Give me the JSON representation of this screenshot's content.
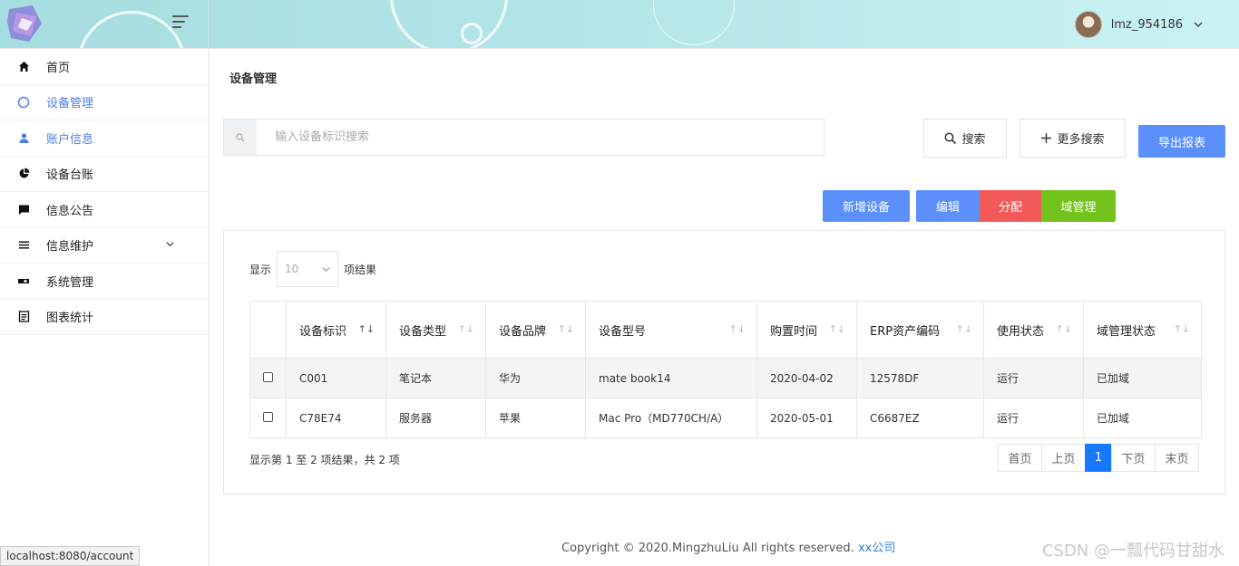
{
  "header": {
    "username": "lmz_954186"
  },
  "sidebar": {
    "items": [
      {
        "label": "首页",
        "icon": "home-icon"
      },
      {
        "label": "设备管理",
        "icon": "circle-icon"
      },
      {
        "label": "账户信息",
        "icon": "user-icon"
      },
      {
        "label": "设备台账",
        "icon": "pie-chart-icon"
      },
      {
        "label": "信息公告",
        "icon": "message-icon"
      },
      {
        "label": "信息维护",
        "icon": "list-icon"
      },
      {
        "label": "系统管理",
        "icon": "toggle-icon"
      },
      {
        "label": "图表统计",
        "icon": "document-icon"
      }
    ]
  },
  "main": {
    "title": "设备管理",
    "search_placeholder": "输入设备标识搜索",
    "search_label": "搜索",
    "more_search_label": "更多搜索",
    "export_label": "导出报表",
    "add_label": "新增设备",
    "edit_label": "编辑",
    "assign_label": "分配",
    "domain_label": "域管理"
  },
  "table": {
    "show_prefix": "显示",
    "page_size": "10",
    "show_suffix": "项结果",
    "columns": [
      "设备标识",
      "设备类型",
      "设备品牌",
      "设备型号",
      "购置时间",
      "ERP资产编码",
      "使用状态",
      "域管理状态"
    ],
    "rows": [
      [
        "C001",
        "笔记本",
        "华为",
        "mate book14",
        "2020-04-02",
        "12578DF",
        "运行",
        "已加域"
      ],
      [
        "C78E74",
        "服务器",
        "苹果",
        "Mac Pro（MD770CH/A）",
        "2020-05-01",
        "C6687EZ",
        "运行",
        "已加域"
      ]
    ],
    "info": "显示第 1 至 2 项结果，共 2 项"
  },
  "pagination": {
    "first": "首页",
    "prev": "上页",
    "current": "1",
    "next": "下页",
    "last": "末页"
  },
  "footer": {
    "text": "Copyright © 2020.MingzhuLiu All rights reserved.",
    "link": "xx公司"
  },
  "watermark": "CSDN @一瓢代码甘甜水",
  "statusbar": "localhost:8080/account",
  "colors": {
    "primary": "#5b8ff9",
    "danger": "#f25a5a",
    "success": "#73c21c",
    "page_active": "#1677ff"
  }
}
